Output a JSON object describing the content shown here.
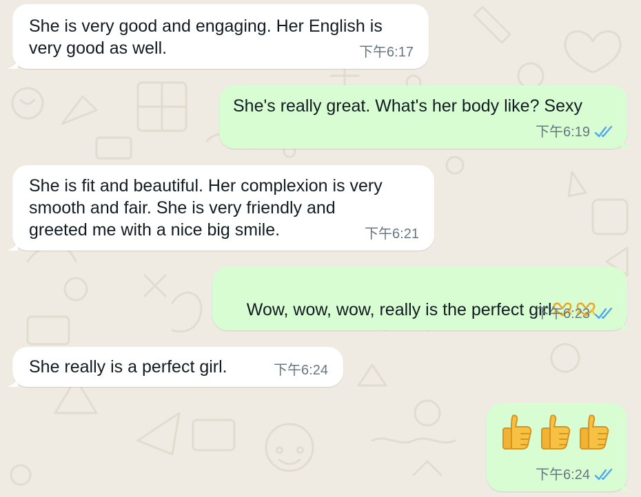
{
  "colors": {
    "wallpaper": "#efeae2",
    "incoming_bubble": "#ffffff",
    "outgoing_bubble": "#d9fdd3",
    "text": "#111b21",
    "timestamp": "#667781",
    "read_ticks": "#4fa6e9"
  },
  "messages": [
    {
      "direction": "incoming",
      "text": "She is very good and engaging. Her English is\nvery good as well.",
      "time": "下午6:17"
    },
    {
      "direction": "outgoing",
      "text": "She's really great. What's her body like? Sexy",
      "time": "下午6:19",
      "status": "read"
    },
    {
      "direction": "incoming",
      "text": "She is fit and beautiful. Her complexion is very\nsmooth and fair. She is very friendly and\ngreeted me with a nice big smile.",
      "time": "下午6:21"
    },
    {
      "direction": "outgoing",
      "text": "Wow, wow, wow, really is the perfect girl",
      "emoji": [
        "heart-hands",
        "heart-hands"
      ],
      "time": "下午6:23",
      "status": "read"
    },
    {
      "direction": "incoming",
      "text": "She really is a perfect girl.",
      "time": "下午6:24"
    },
    {
      "direction": "outgoing",
      "emoji": [
        "thumbs-up",
        "thumbs-up",
        "thumbs-up"
      ],
      "time": "下午6:24",
      "status": "read"
    }
  ]
}
